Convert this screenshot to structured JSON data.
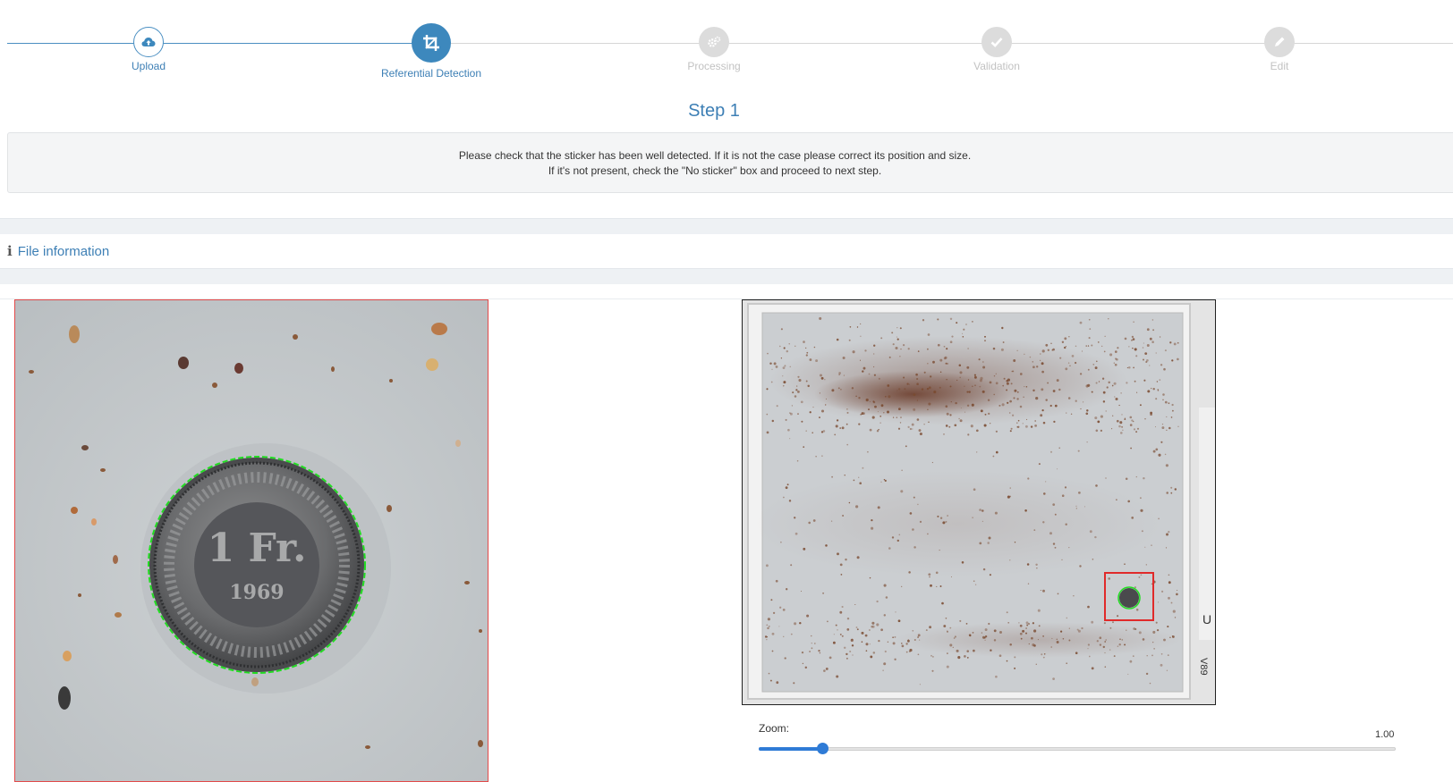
{
  "stepper": {
    "steps": [
      {
        "label": "Upload",
        "icon": "cloud-upload-icon",
        "state": "done"
      },
      {
        "label": "Referential Detection",
        "icon": "crop-icon",
        "state": "active"
      },
      {
        "label": "Processing",
        "icon": "gears-icon",
        "state": "todo"
      },
      {
        "label": "Validation",
        "icon": "check-icon",
        "state": "todo"
      },
      {
        "label": "Edit",
        "icon": "pencil-icon",
        "state": "todo"
      }
    ]
  },
  "header": {
    "title": "Step 1",
    "instruction_line1": "Please check that the sticker has been well detected. If it is not the case please correct its position and size.",
    "instruction_line2": "If it's not present, check the \"No sticker\" box and proceed to next step."
  },
  "file_info": {
    "label": "File information",
    "icon": "info-icon"
  },
  "images": {
    "coin": {
      "lettering": "1 Fr. 1969"
    },
    "tray": {
      "label": "V89"
    }
  },
  "zoom": {
    "label": "Zoom:",
    "value_text": "1.00",
    "fraction": 0.1
  },
  "colors": {
    "accent": "#3d88bd",
    "detection_box": "#e02a2a",
    "detection_circle": "#22dd22"
  }
}
